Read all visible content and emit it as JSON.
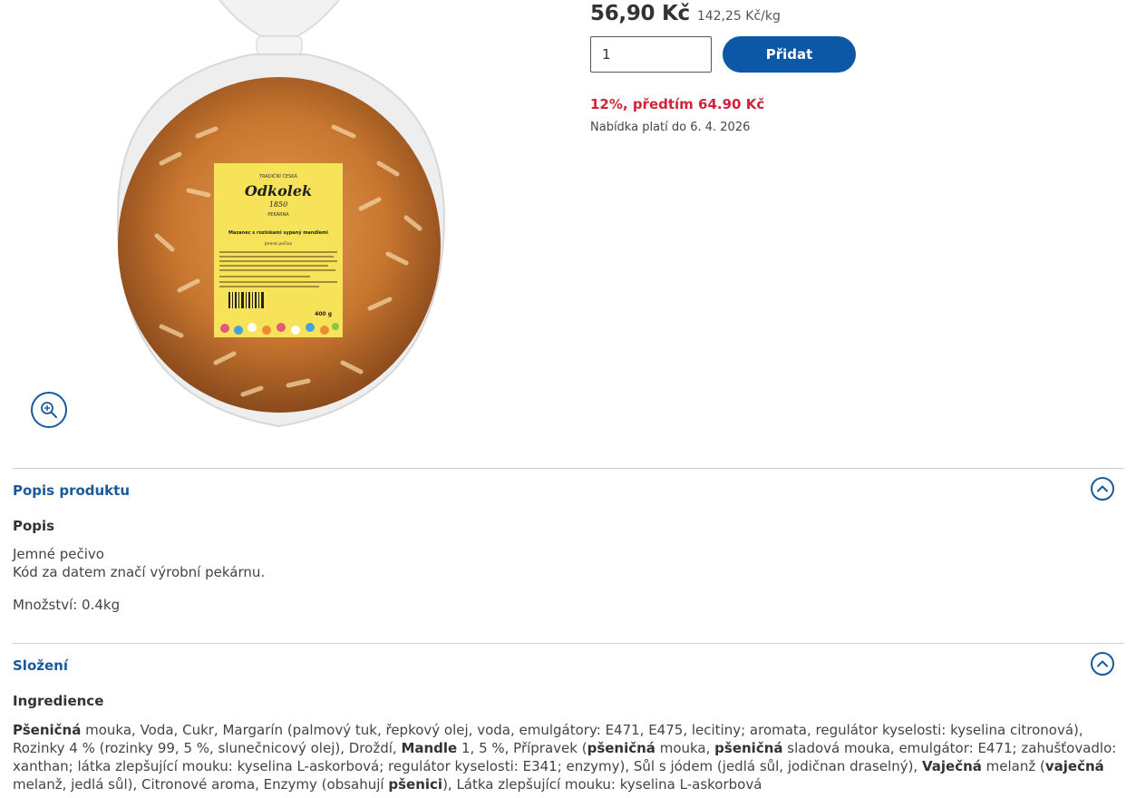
{
  "product": {
    "price": "56,90 Kč",
    "unit_price": "142,25 Kč/kg",
    "quantity": "1",
    "add_label": "Přidat",
    "discount": "12%, předtím 64.90 Kč",
    "offer_validity": "Nabídka platí do 6. 4. 2026"
  },
  "label": {
    "brand": "Odkolek",
    "year": "1850",
    "tagline": "TRADIČNÍ ČESKÁ",
    "bakery": "PEKÁRNA",
    "product_name": "Mazanec s rozinkami sypaný mandlemi",
    "type": "Jemné pečivo",
    "weight": "400 g"
  },
  "description": {
    "title": "Popis produktu",
    "subtitle": "Popis",
    "line1": "Jemné pečivo",
    "line2": "Kód za datem značí výrobní pekárnu.",
    "quantity": "Množství: 0.4kg"
  },
  "composition": {
    "title": "Složení",
    "subtitle": "Ingredience",
    "ingredients": [
      {
        "text": "Pšeničná",
        "bold": true
      },
      {
        "text": " mouka, Voda, Cukr, Margarín (palmový tuk, řepkový olej, voda, emulgátory: E471, E475, lecitiny; aromata, regulátor kyselosti: kyselina citronová), Rozinky 4 % (rozinky 99, 5 %, slunečnicový olej), Droždí, ",
        "bold": false
      },
      {
        "text": "Mandle",
        "bold": true
      },
      {
        "text": " 1, 5 %, Přípravek (",
        "bold": false
      },
      {
        "text": "pšeničná",
        "bold": true
      },
      {
        "text": " mouka, ",
        "bold": false
      },
      {
        "text": "pšeničná",
        "bold": true
      },
      {
        "text": " sladová mouka, emulgátor: E471; zahušťovadlo: xanthan; látka zlepšující mouku: kyselina L-askorbová; regulátor kyselosti: E341; enzymy), Sůl s jódem (jedlá sůl, jodičnan draselný), ",
        "bold": false
      },
      {
        "text": "Vaječná",
        "bold": true
      },
      {
        "text": " melanž (",
        "bold": false
      },
      {
        "text": "vaječná",
        "bold": true
      },
      {
        "text": " melanž, jedlá sůl), Citronové aroma, Enzymy (obsahují ",
        "bold": false
      },
      {
        "text": "pšenici",
        "bold": true
      },
      {
        "text": "), Látka zlepšující mouku: kyselina L-askorbová",
        "bold": false
      }
    ]
  },
  "icons": {
    "zoom": "zoom-in-icon",
    "toggle": "chevron-up-icon"
  },
  "colors": {
    "accent": "#0d58a6",
    "link": "#1a5a9a",
    "discount": "#d0243a",
    "label_yellow": "#f7e35a"
  }
}
